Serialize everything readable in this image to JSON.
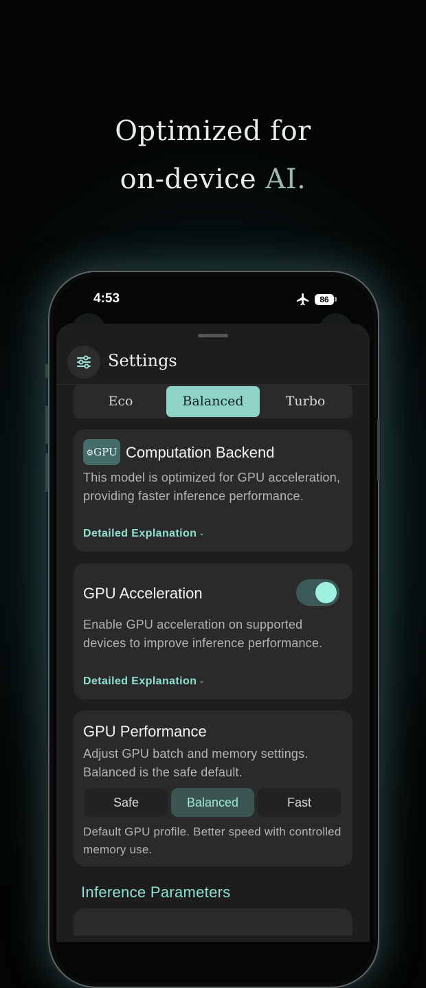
{
  "headline": {
    "line1": "Optimized for",
    "line2_prefix": "on-device ",
    "line2_accent": "AI."
  },
  "status_bar": {
    "time": "4:53",
    "battery": "86",
    "icons": [
      "airplane-icon",
      "battery-icon"
    ]
  },
  "sheet": {
    "title": "Settings",
    "title_icon": "sliders-icon"
  },
  "mode_selector": {
    "options": [
      "Eco",
      "Balanced",
      "Turbo"
    ],
    "selected": "Balanced"
  },
  "backend_card": {
    "badge": "GPU",
    "badge_icon": "chip-icon",
    "title": "Computation Backend",
    "description": "This model is optimized for GPU acceleration, providing faster inference performance.",
    "link": "Detailed Explanation"
  },
  "acceleration_card": {
    "title": "GPU Acceleration",
    "enabled": true,
    "description": "Enable GPU acceleration on supported devices to improve inference performance.",
    "link": "Detailed Explanation"
  },
  "performance_card": {
    "title": "GPU Performance",
    "description": "Adjust GPU batch and memory settings. Balanced is the safe default.",
    "options": [
      "Safe",
      "Balanced",
      "Fast"
    ],
    "selected": "Balanced",
    "footnote": "Default GPU profile. Better speed with controlled memory use."
  },
  "inference_section": {
    "title": "Inference Parameters"
  },
  "colors": {
    "accent": "#8fe0d0",
    "segment_active": "#8fd3c7",
    "card_bg": "#2a2a2a",
    "sheet_bg": "#1d1d1d"
  }
}
